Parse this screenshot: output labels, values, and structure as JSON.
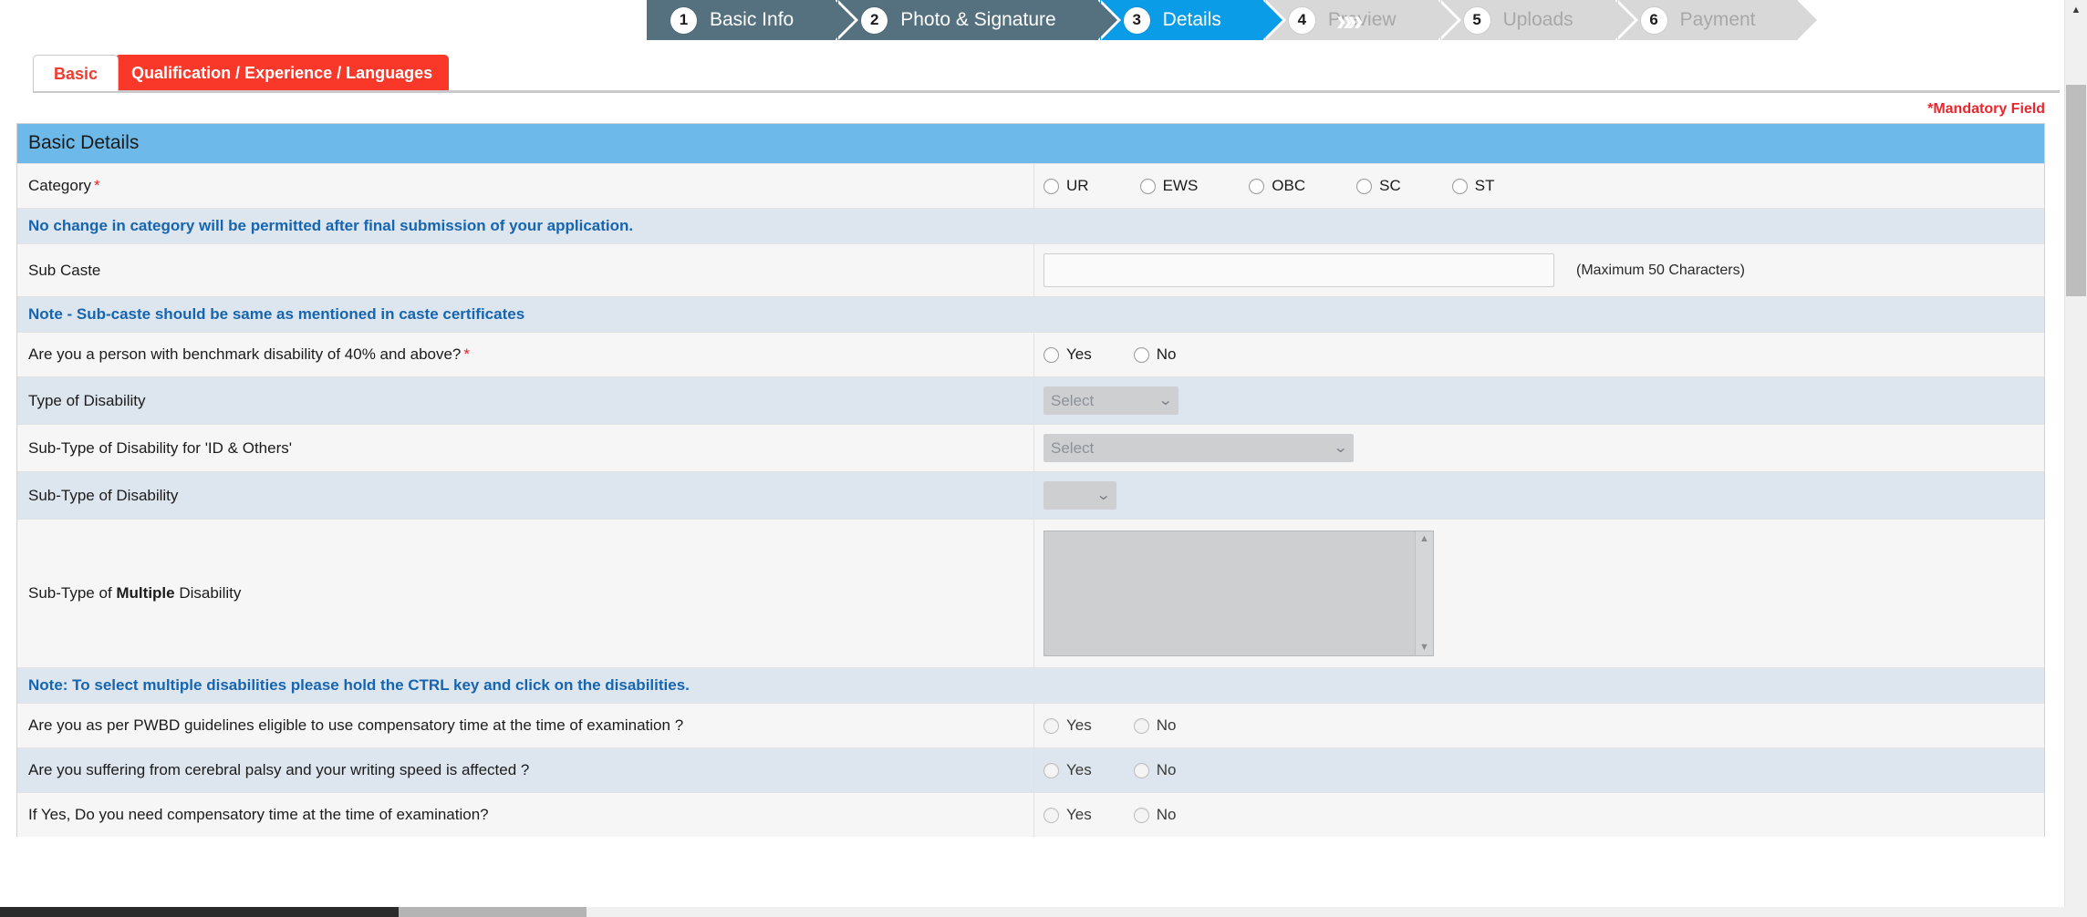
{
  "wizard": {
    "chevron_icon": "double-chevron-right",
    "steps": [
      {
        "num": "1",
        "label": "Basic Info",
        "state": "done"
      },
      {
        "num": "2",
        "label": "Photo & Signature",
        "state": "done"
      },
      {
        "num": "3",
        "label": "Details",
        "state": "active"
      },
      {
        "num": "4",
        "label": "Preview",
        "state": "todo"
      },
      {
        "num": "5",
        "label": "Uploads",
        "state": "todo"
      },
      {
        "num": "6",
        "label": "Payment",
        "state": "todo"
      }
    ]
  },
  "tabs": [
    {
      "label": "Basic",
      "active": false
    },
    {
      "label": "Qualification / Experience / Languages",
      "active": true
    }
  ],
  "mandatory_note": "*Mandatory Field",
  "section": {
    "title": "Basic Details"
  },
  "rows": {
    "category": {
      "label": "Category",
      "required": "*",
      "options": [
        "UR",
        "EWS",
        "OBC",
        "SC",
        "ST"
      ]
    },
    "category_note": "No change in category will be permitted after final submission of your application.",
    "sub_caste": {
      "label": "Sub Caste",
      "value": "",
      "placeholder": "",
      "helper": "(Maximum 50 Characters)"
    },
    "sub_caste_note": "Note - Sub-caste should be same as mentioned in caste certificates",
    "benchmark_disability": {
      "label": "Are you a person with benchmark disability of 40% and above?",
      "required": "*",
      "options": [
        "Yes",
        "No"
      ]
    },
    "type_of_disability": {
      "label": "Type of Disability",
      "value": "Select"
    },
    "subtype_id_others": {
      "label": "Sub-Type of Disability for 'ID & Others'",
      "value": "Select"
    },
    "subtype_disability": {
      "label": "Sub-Type of Disability",
      "value": ""
    },
    "subtype_multiple": {
      "label_pre": "Sub-Type of ",
      "label_strong": "Multiple",
      "label_post": " Disability"
    },
    "multiple_note": "Note: To select multiple disabilities please hold the CTRL key and click on the disabilities.",
    "pwbd_compensatory": {
      "label": "Are you as per PWBD guidelines eligible to use compensatory time at the time of examination ?",
      "options": [
        "Yes",
        "No"
      ]
    },
    "cerebral_palsy": {
      "label": "Are you suffering from cerebral palsy and your writing speed is affected ?",
      "options": [
        "Yes",
        "No"
      ]
    },
    "need_compensatory": {
      "label": "If Yes, Do you need compensatory time at the time of examination?",
      "options": [
        "Yes",
        "No"
      ]
    }
  },
  "colors": {
    "accent_blue": "#0b9ce8",
    "section_header": "#6cb9ea",
    "tab_active": "#f9382a",
    "mandatory_red": "#e8262d",
    "note_blue": "#1565b0",
    "step_done": "#55707f"
  },
  "icons": {
    "scroll_up": "▲",
    "scroll_down": "▼",
    "caret_down": "⌄"
  }
}
